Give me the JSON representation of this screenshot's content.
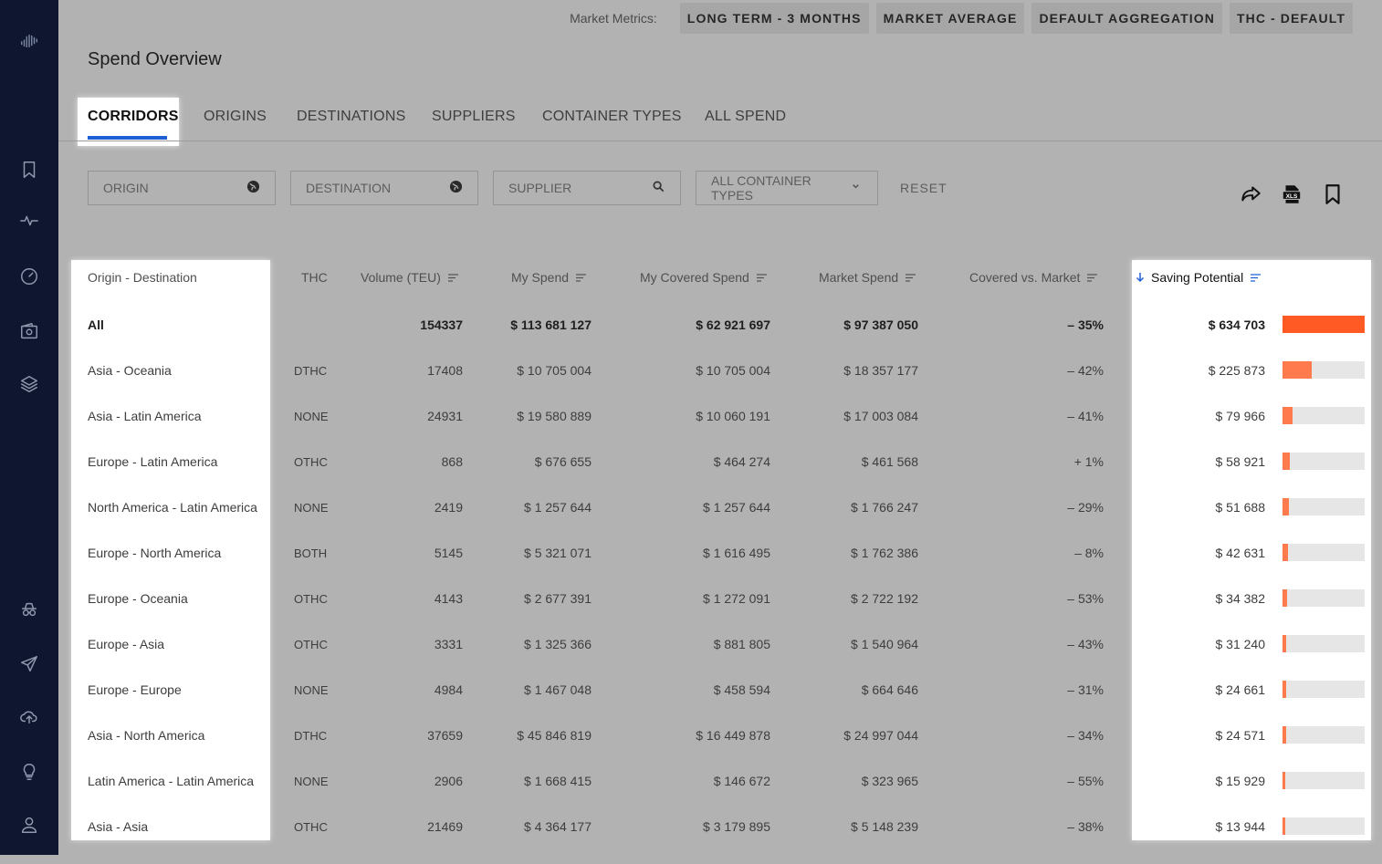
{
  "header": {
    "metrics_label": "Market Metrics:",
    "metric_buttons": [
      "LONG TERM - 3 MONTHS",
      "MARKET AVERAGE",
      "DEFAULT AGGREGATION",
      "THC - DEFAULT"
    ],
    "page_title": "Spend Overview"
  },
  "tabs": [
    "CORRIDORS",
    "ORIGINS",
    "DESTINATIONS",
    "SUPPLIERS",
    "CONTAINER TYPES",
    "ALL SPEND"
  ],
  "active_tab": "CORRIDORS",
  "filters": {
    "origin_placeholder": "ORIGIN",
    "destination_placeholder": "DESTINATION",
    "supplier_placeholder": "SUPPLIER",
    "container_select": "ALL CONTAINER TYPES",
    "reset": "RESET"
  },
  "toolbar_icons": [
    "share-icon",
    "xls-export-icon",
    "bookmark-icon"
  ],
  "sidebar_icons": [
    "logo-icon",
    "bookmark-icon",
    "pulse-icon",
    "speedometer-icon",
    "wallet-icon",
    "layers-icon",
    "incognito-icon",
    "airplane-icon",
    "cloud-upload-icon",
    "lightbulb-icon",
    "user-icon"
  ],
  "colors": {
    "accent": "#1f5fd6",
    "bar_primary": "#ff5a24",
    "bar": "#ff7a4d",
    "sidebar": "#0f1730"
  },
  "table": {
    "columns": {
      "corridor": "Origin - Destination",
      "thc": "THC",
      "volume": "Volume (TEU)",
      "my_spend": "My Spend",
      "covered": "My Covered Spend",
      "market": "Market Spend",
      "vs_market": "Covered vs. Market",
      "saving": "Saving Potential"
    },
    "rows": [
      {
        "corridor": "All",
        "thc": "",
        "volume": "154337",
        "my_spend": "$ 113 681 127",
        "covered": "$ 62 921 697",
        "market": "$ 97 387 050",
        "vs_market": "– 35%",
        "saving": "$ 634 703",
        "saving_ratio": 1.0
      },
      {
        "corridor": "Asia - Oceania",
        "thc": "DTHC",
        "volume": "17408",
        "my_spend": "$ 10 705 004",
        "covered": "$ 10 705 004",
        "market": "$ 18 357 177",
        "vs_market": "– 42%",
        "saving": "$ 225 873",
        "saving_ratio": 0.356
      },
      {
        "corridor": "Asia - Latin America",
        "thc": "NONE",
        "volume": "24931",
        "my_spend": "$ 19 580 889",
        "covered": "$ 10 060 191",
        "market": "$ 17 003 084",
        "vs_market": "– 41%",
        "saving": "$ 79 966",
        "saving_ratio": 0.126
      },
      {
        "corridor": "Europe - Latin America",
        "thc": "OTHC",
        "volume": "868",
        "my_spend": "$ 676 655",
        "covered": "$ 464 274",
        "market": "$ 461 568",
        "vs_market": "+ 1%",
        "saving": "$ 58 921",
        "saving_ratio": 0.093
      },
      {
        "corridor": "North America - Latin America",
        "thc": "NONE",
        "volume": "2419",
        "my_spend": "$ 1 257 644",
        "covered": "$ 1 257 644",
        "market": "$ 1 766 247",
        "vs_market": "– 29%",
        "saving": "$ 51 688",
        "saving_ratio": 0.081
      },
      {
        "corridor": "Europe - North America",
        "thc": "BOTH",
        "volume": "5145",
        "my_spend": "$ 5 321 071",
        "covered": "$ 1 616 495",
        "market": "$ 1 762 386",
        "vs_market": "– 8%",
        "saving": "$ 42 631",
        "saving_ratio": 0.067
      },
      {
        "corridor": "Europe - Oceania",
        "thc": "OTHC",
        "volume": "4143",
        "my_spend": "$ 2 677 391",
        "covered": "$ 1 272 091",
        "market": "$ 2 722 192",
        "vs_market": "– 53%",
        "saving": "$ 34 382",
        "saving_ratio": 0.054
      },
      {
        "corridor": "Europe - Asia",
        "thc": "OTHC",
        "volume": "3331",
        "my_spend": "$ 1 325 366",
        "covered": "$ 881 805",
        "market": "$ 1 540 964",
        "vs_market": "– 43%",
        "saving": "$ 31 240",
        "saving_ratio": 0.049
      },
      {
        "corridor": "Europe - Europe",
        "thc": "NONE",
        "volume": "4984",
        "my_spend": "$ 1 467 048",
        "covered": "$ 458 594",
        "market": "$ 664 646",
        "vs_market": "– 31%",
        "saving": "$ 24 661",
        "saving_ratio": 0.039
      },
      {
        "corridor": "Asia - North America",
        "thc": "DTHC",
        "volume": "37659",
        "my_spend": "$ 45 846 819",
        "covered": "$ 16 449 878",
        "market": "$ 24 997 044",
        "vs_market": "– 34%",
        "saving": "$ 24 571",
        "saving_ratio": 0.039
      },
      {
        "corridor": "Latin America - Latin America",
        "thc": "NONE",
        "volume": "2906",
        "my_spend": "$ 1 668 415",
        "covered": "$ 146 672",
        "market": "$ 323 965",
        "vs_market": "– 55%",
        "saving": "$ 15 929",
        "saving_ratio": 0.025
      },
      {
        "corridor": "Asia - Asia",
        "thc": "OTHC",
        "volume": "21469",
        "my_spend": "$ 4 364 177",
        "covered": "$ 3 179 895",
        "market": "$ 5 148 239",
        "vs_market": "– 38%",
        "saving": "$ 13 944",
        "saving_ratio": 0.022
      }
    ]
  }
}
